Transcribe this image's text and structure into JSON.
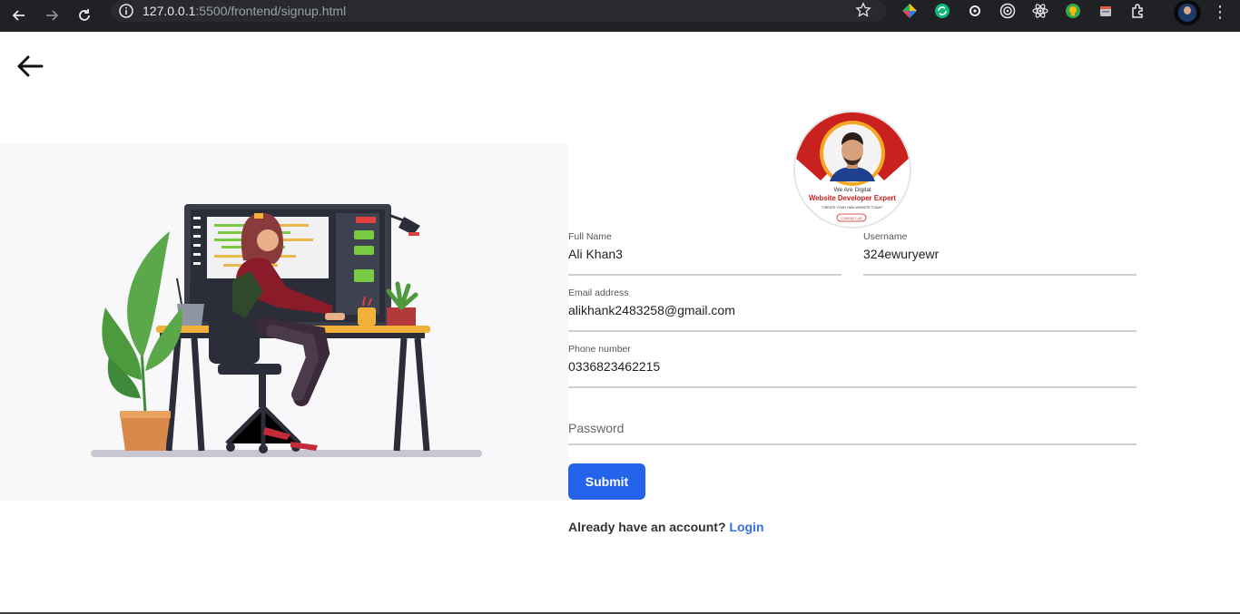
{
  "browser": {
    "url_host": "127.0.0.1",
    "url_rest": ":5500/frontend/signup.html"
  },
  "profile_card": {
    "line1": "We Are Digital",
    "line2": "Website Developer Expert",
    "line3": "\"CREATE YOUR OWN WEBSITE TODAY\"",
    "button": "CONTACT US"
  },
  "form": {
    "full_name": {
      "label": "Full Name",
      "value": "Ali Khan3"
    },
    "username": {
      "label": "Username",
      "value": "324ewuryewr"
    },
    "email": {
      "label": "Email address",
      "value": "alikhank2483258@gmail.com"
    },
    "phone": {
      "label": "Phone number",
      "value": "0336823462215"
    },
    "password": {
      "placeholder": "Password"
    },
    "submit_label": "Submit",
    "login_prompt": "Already have an account?",
    "login_link": "Login"
  },
  "colors": {
    "primary": "#2563eb",
    "link": "#3b6fe0",
    "chrome_bg": "#202124"
  },
  "icons": [
    "back-arrow-icon",
    "forward-arrow-icon",
    "reload-icon",
    "info-icon",
    "star-icon",
    "extension-icon",
    "kebab-menu-icon",
    "page-back-arrow-icon"
  ]
}
